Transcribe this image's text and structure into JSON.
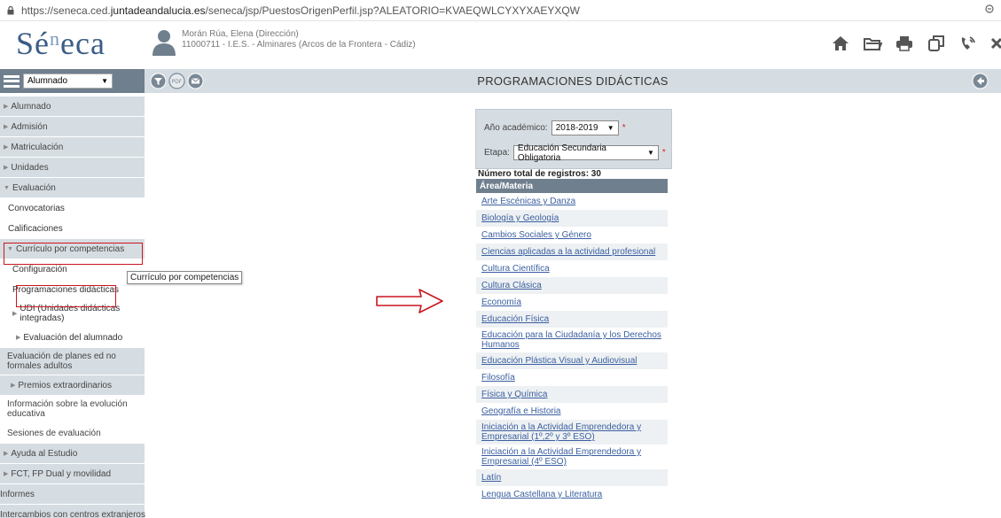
{
  "browser": {
    "url_prefix": "https://seneca.ced.",
    "url_host": "juntadeandalucia.es",
    "url_path": "/seneca/jsp/PuestosOrigenPerfil.jsp?ALEATORIO=KVAEQWLCYXYXAEYXQW"
  },
  "header": {
    "logo": "Séneca",
    "user_name": "Morán Rúa, Elena (Dirección)",
    "user_center": "11000711 - I.E.S. - Alminares (Arcos de la Frontera - Cádiz)",
    "icons": [
      "home-icon",
      "folder-icon",
      "print-icon",
      "copy-icon",
      "phone-icon",
      "close-icon"
    ]
  },
  "sidebar": {
    "profile_select": "Alumnado",
    "items": [
      {
        "label": "Alumnado",
        "level": 1
      },
      {
        "label": "Admisión",
        "level": 1
      },
      {
        "label": "Matriculación",
        "level": 1
      },
      {
        "label": "Unidades",
        "level": 1
      },
      {
        "label": "Evaluación",
        "level": 1
      },
      {
        "label": "Convocatorias",
        "level": 2
      },
      {
        "label": "Calificaciones",
        "level": 2
      },
      {
        "label": "Currículo por competencias",
        "level": 2
      },
      {
        "label": "Configuración",
        "level": 3
      },
      {
        "label": "Programaciones didácticas",
        "level": 3
      },
      {
        "label": "UDI (Unidades didácticas integradas)",
        "level": 3
      },
      {
        "label": "Evaluación del alumnado",
        "level": 3
      },
      {
        "label": "Evaluación de planes ed no formales adultos",
        "level": 2
      },
      {
        "label": "Premios extraordinarios",
        "level": 2
      },
      {
        "label": "Información sobre la evolución educativa",
        "level": 2
      },
      {
        "label": "Sesiones de evaluación",
        "level": 2
      },
      {
        "label": "Ayuda al Estudio",
        "level": 1
      },
      {
        "label": "FCT, FP Dual y movilidad",
        "level": 1
      },
      {
        "label": "Informes",
        "level": 0
      },
      {
        "label": "Intercambios con centros extranjeros",
        "level": 0
      }
    ],
    "tooltip": "Currículo por competencias"
  },
  "main": {
    "title": "PROGRAMACIONES DIDÁCTICAS",
    "form": {
      "year_label": "Año académico:",
      "year_value": "2018-2019",
      "stage_label": "Etapa:",
      "stage_value": "Educación Secundaria Obligatoria",
      "required_mark": "*"
    },
    "total_label": "Número total de registros: 30",
    "table_header": "Área/Materia",
    "rows": [
      "Arte Escénicas y Danza",
      "Biología y Geología",
      "Cambios Sociales y Género",
      "Ciencias aplicadas a la actividad profesional",
      "Cultura Científica",
      "Cultura Clásica",
      "Economía",
      "Educación Física",
      "Educación para la Ciudadanía y los Derechos Humanos",
      "Educación Plástica Visual y Audiovisual",
      "Filosofía",
      "Física y Química",
      "Geografía e Historia",
      "Iniciación a la Actividad Emprendedora y Empresarial (1º,2º y 3º ESO)",
      "Iniciación a la Actividad Emprendedora y Empresarial (4º ESO)",
      "Latín",
      "Lengua Castellana y Literatura"
    ]
  },
  "colors": {
    "accent": "#6f7f8e",
    "sidebar_bg": "#d6dde2",
    "highlight": "#c8171e",
    "link": "#3a5fa0"
  }
}
